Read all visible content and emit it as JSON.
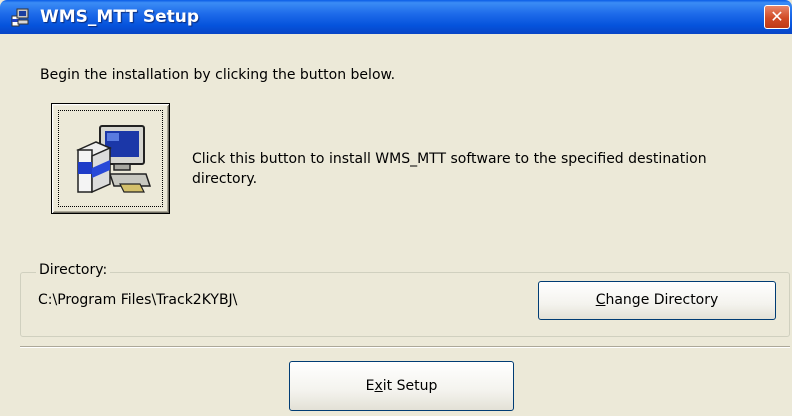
{
  "window": {
    "title": "WMS_MTT Setup",
    "close_label": "✕"
  },
  "intro_text": "Begin the installation by clicking the button below.",
  "install": {
    "description": "Click this button to install WMS_MTT software to the specified destination directory."
  },
  "directory": {
    "legend": "Directory:",
    "path": "C:\\Program Files\\Track2KYBJ\\",
    "change_button": {
      "pre": "",
      "accel": "C",
      "post": "hange Directory"
    }
  },
  "exit_button": {
    "pre": "E",
    "accel": "x",
    "post": "it Setup"
  },
  "colors": {
    "titlebar": "#0553dc",
    "face": "#ece9d8",
    "close": "#d14b26"
  },
  "icons": [
    "setup-app-icon",
    "close-icon",
    "computer-install-icon"
  ]
}
